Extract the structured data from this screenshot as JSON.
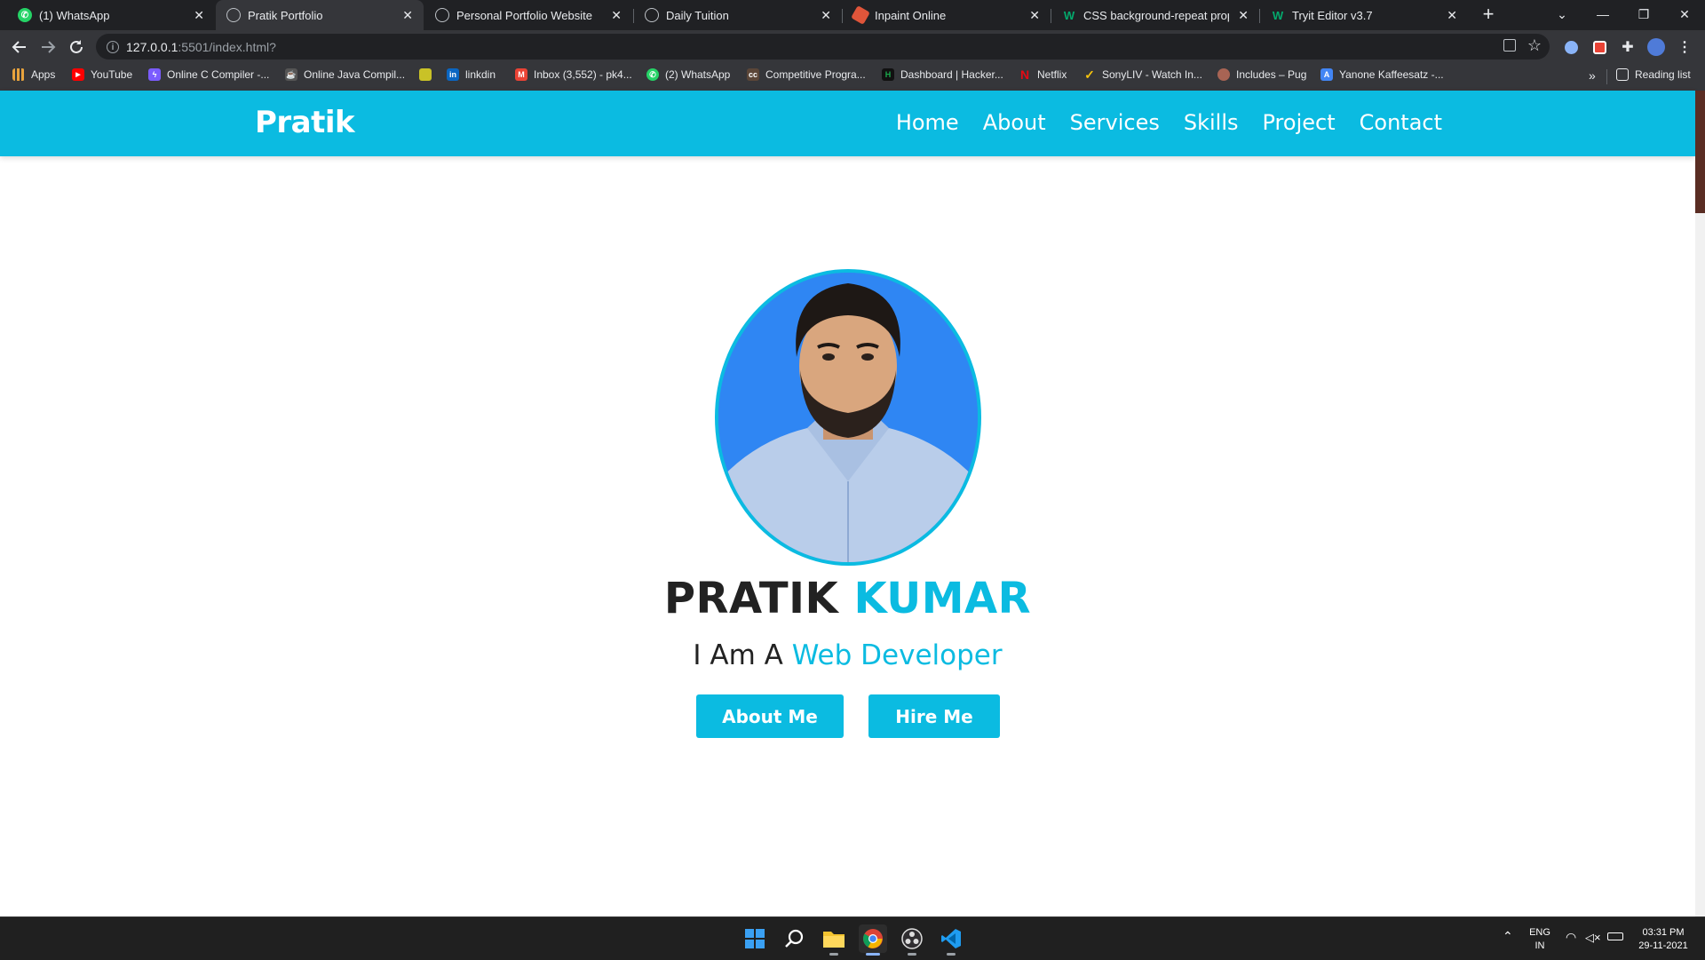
{
  "browser": {
    "tabs": [
      {
        "label": "(1) WhatsApp",
        "icon": "whatsapp-icon",
        "active": false
      },
      {
        "label": "Pratik Portfolio",
        "icon": "globe-icon",
        "active": true
      },
      {
        "label": "Personal Portfolio Website",
        "icon": "globe-icon",
        "active": false
      },
      {
        "label": "Daily Tuition",
        "icon": "globe-icon",
        "active": false
      },
      {
        "label": "Inpaint Online",
        "icon": "inpaint-icon",
        "active": false
      },
      {
        "label": "CSS background-repeat propert",
        "icon": "w3schools-icon",
        "active": false
      },
      {
        "label": "Tryit Editor v3.7",
        "icon": "w3schools-icon",
        "active": false
      }
    ],
    "url_host": "127.0.0.1",
    "url_path": ":5501/index.html?",
    "bookmarks": [
      {
        "label": "Apps",
        "icon": "apps-grid-icon",
        "color": "#e8a33d"
      },
      {
        "label": "YouTube",
        "icon": "youtube-icon",
        "color": "#ff0000"
      },
      {
        "label": "Online C Compiler -...",
        "icon": "bolt-icon",
        "color": "#7b5cff"
      },
      {
        "label": "Online Java Compil...",
        "icon": "java-icon",
        "color": "#555555"
      },
      {
        "label": "",
        "icon": "image-icon",
        "color": "#c9c227"
      },
      {
        "label": "linkdin",
        "icon": "linkedin-icon",
        "color": "#0a66c2"
      },
      {
        "label": "Inbox (3,552) - pk4...",
        "icon": "gmail-icon",
        "color": "#ea4335"
      },
      {
        "label": "(2) WhatsApp",
        "icon": "whatsapp-icon",
        "color": "#25d366"
      },
      {
        "label": "Competitive Progra...",
        "icon": "codechef-icon",
        "color": "#5b4638"
      },
      {
        "label": "Dashboard | Hacker...",
        "icon": "hackerrank-icon",
        "color": "#1ba94c"
      },
      {
        "label": "Netflix",
        "icon": "netflix-icon",
        "color": "#e50914"
      },
      {
        "label": "SonyLIV - Watch In...",
        "icon": "sonyliv-icon",
        "color": "#f4c20d"
      },
      {
        "label": "Includes – Pug",
        "icon": "pug-icon",
        "color": "#a86454"
      },
      {
        "label": "Yanone Kaffeesatz -...",
        "icon": "google-fonts-icon",
        "color": "#4285f4"
      }
    ],
    "reading_list": "Reading list"
  },
  "site": {
    "logo": "Pratik",
    "nav": [
      "Home",
      "About",
      "Services",
      "Skills",
      "Project",
      "Contact"
    ],
    "hero": {
      "first_name": "PRATIK",
      "last_name": "KUMAR",
      "role_prefix": "I Am A",
      "role": "Web Developer",
      "buttons": [
        "About Me",
        "Hire Me"
      ]
    },
    "accent_color": "#0bbbe1"
  },
  "taskbar": {
    "apps": [
      "windows-start-icon",
      "search-icon",
      "file-explorer-icon",
      "chrome-icon",
      "obs-icon",
      "vscode-icon"
    ],
    "language": "ENG",
    "region": "IN",
    "time": "03:31 PM",
    "date": "29-11-2021"
  }
}
